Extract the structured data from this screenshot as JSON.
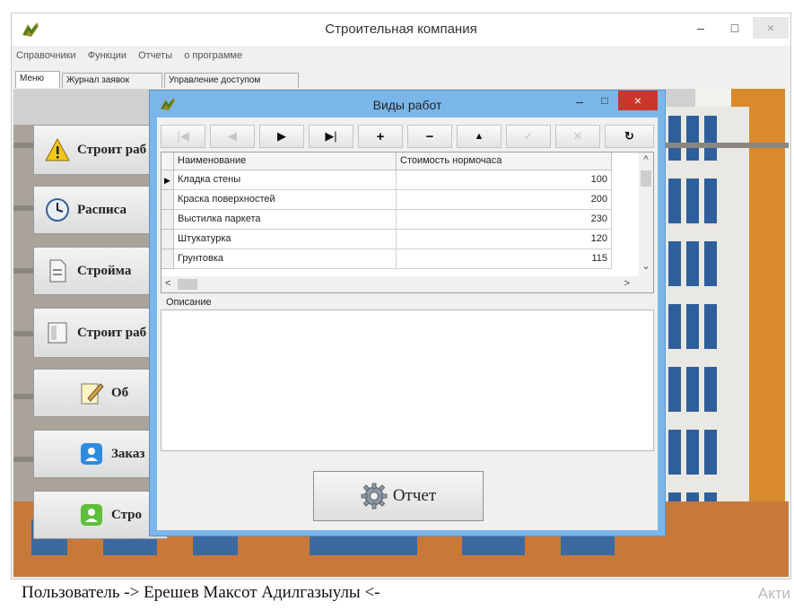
{
  "main_window": {
    "title": "Строительная компания",
    "minimize": "–",
    "maximize": "□",
    "close": "×"
  },
  "menubar": [
    "Справочники",
    "Функции",
    "Отчеты",
    "о программе"
  ],
  "tabs": [
    "Меню",
    "Журнал заявок",
    "Управление доступом"
  ],
  "menu_buttons": [
    "Строит раб",
    "Расписа",
    "Строймa",
    "Строит раб",
    "Об",
    "Заказ",
    "Стро"
  ],
  "dialog": {
    "title": "Виды работ",
    "minimize": "–",
    "maximize": "□",
    "close": "×",
    "toolbar": [
      "|◀",
      "◀",
      "▶",
      "▶|",
      "+",
      "−",
      "▲",
      "✓",
      "✕",
      "↻"
    ],
    "columns": [
      "Наименование",
      "Стоимость нормочаса"
    ],
    "rows": [
      {
        "name": "Кладка стены",
        "cost": "100"
      },
      {
        "name": "Краска поверхностей",
        "cost": "200"
      },
      {
        "name": "Выстилка паркета",
        "cost": "230"
      },
      {
        "name": "Штукатурка",
        "cost": "120"
      },
      {
        "name": "Грунтовка",
        "cost": "115"
      }
    ],
    "current_row_marker": "▶",
    "scroll_up": "^",
    "scroll_down": "⌄",
    "scroll_left": "<",
    "scroll_right": ">",
    "description_label": "Описание",
    "report_button": "Отчет"
  },
  "status": {
    "text": "Пользователь   ->   Ерешев Максот Адилгазыулы  <-",
    "watermark": "Акти"
  },
  "colors": {
    "dialog_frame": "#7bb6ea",
    "close_red": "#c9372c",
    "window_bg": "#f0f0f0"
  }
}
